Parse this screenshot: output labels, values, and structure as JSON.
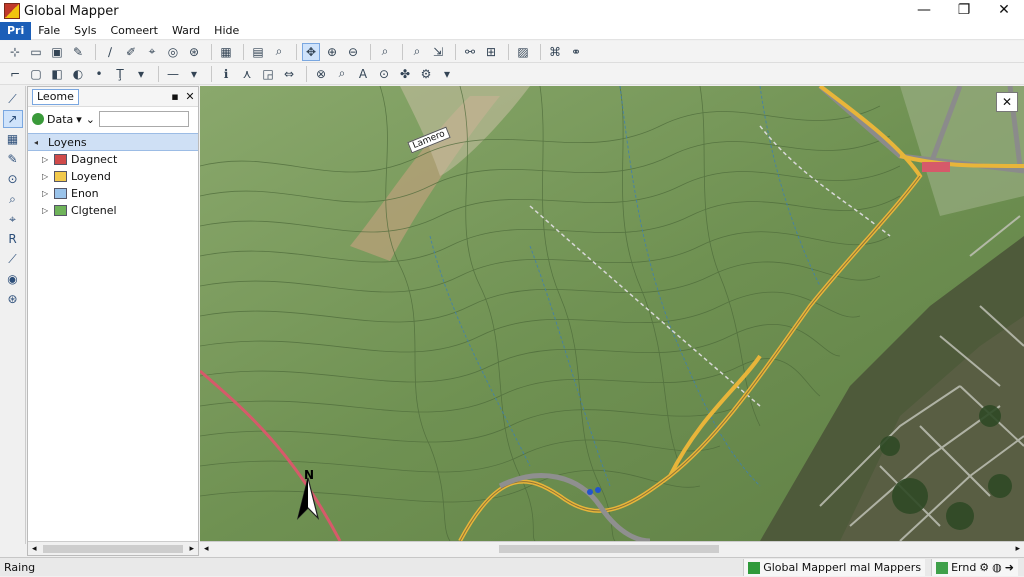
{
  "app": {
    "title": "Global Mapper"
  },
  "window": {
    "minimize": "—",
    "maximize": "❐",
    "close": "✕"
  },
  "menu": [
    "Pri",
    "Fale",
    "Syls",
    "Comeert",
    "Ward",
    "Hide"
  ],
  "panel": {
    "title": "Leome",
    "data_label": "Data",
    "search_placeholder": "",
    "root": "Loyens",
    "layers": [
      {
        "label": "Dagnect",
        "icon": "raster-layer-icon",
        "color": "#d04a4a"
      },
      {
        "label": "Loyend",
        "icon": "folder-layer-icon",
        "color": "#f2c94c"
      },
      {
        "label": "Enon",
        "icon": "document-layer-icon",
        "color": "#9ac3ea"
      },
      {
        "label": "Clgtenel",
        "icon": "image-layer-icon",
        "color": "#6fb35a"
      }
    ]
  },
  "map": {
    "north_label": "N",
    "peak_label": "Lamero"
  },
  "status": {
    "left": "Raing",
    "center": "Global Mapperl mal Mappers",
    "right": "Ernd"
  },
  "colors": {
    "accent": "#1c5fb8",
    "terrain": "#7a9a5e",
    "road": "#e8b53a",
    "boundary": "#d65a6a"
  }
}
